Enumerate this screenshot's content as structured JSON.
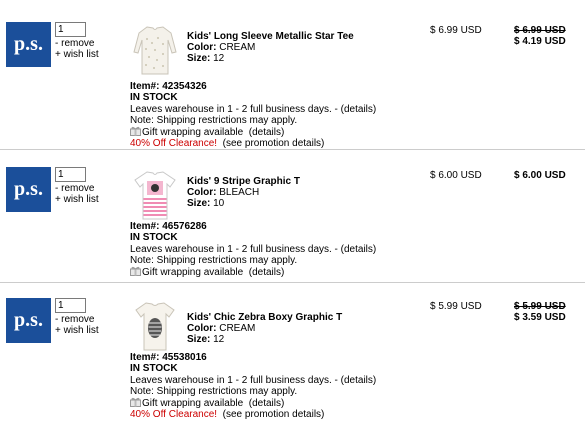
{
  "logo_text": "p.s.",
  "labels": {
    "remove": "- remove",
    "wishlist": "+ wish list",
    "color": "Color:",
    "size": "Size:",
    "item_number": "Item#:",
    "ship_note": "Leaves warehouse in 1 - 2 full business days. - (details)",
    "restriction_note": "Note: Shipping restrictions may apply.",
    "gift_text": "Gift wrapping available",
    "gift_details": "(details)",
    "promo_details": "(see promotion details)"
  },
  "items": [
    {
      "quantity": "1",
      "name": "Kids' Long Sleeve Metallic Star Tee",
      "color": "CREAM",
      "size": "12",
      "item_number": "42354326",
      "stock": "IN STOCK",
      "promo": "40% Off Clearance!",
      "unit_price": "$ 6.99 USD",
      "original_total": "$ 6.99 USD",
      "total": "$ 4.19 USD"
    },
    {
      "quantity": "1",
      "name": "Kids' 9 Stripe Graphic T",
      "color": "BLEACH",
      "size": "10",
      "item_number": "46576286",
      "stock": "IN STOCK",
      "promo": "",
      "unit_price": "$ 6.00 USD",
      "original_total": "",
      "total": "$ 6.00 USD"
    },
    {
      "quantity": "1",
      "name": "Kids' Chic Zebra Boxy Graphic T",
      "color": "CREAM",
      "size": "12",
      "item_number": "45538016",
      "stock": "IN STOCK",
      "promo": "40% Off Clearance!",
      "unit_price": "$ 5.99 USD",
      "original_total": "$ 5.99 USD",
      "total": "$ 3.59 USD"
    }
  ],
  "colors": {
    "logo_bg": "#1b4f9a",
    "promo": "#cc0000",
    "divider": "#cccccc"
  },
  "icons": [
    "gift-icon",
    "shirt-icon"
  ]
}
